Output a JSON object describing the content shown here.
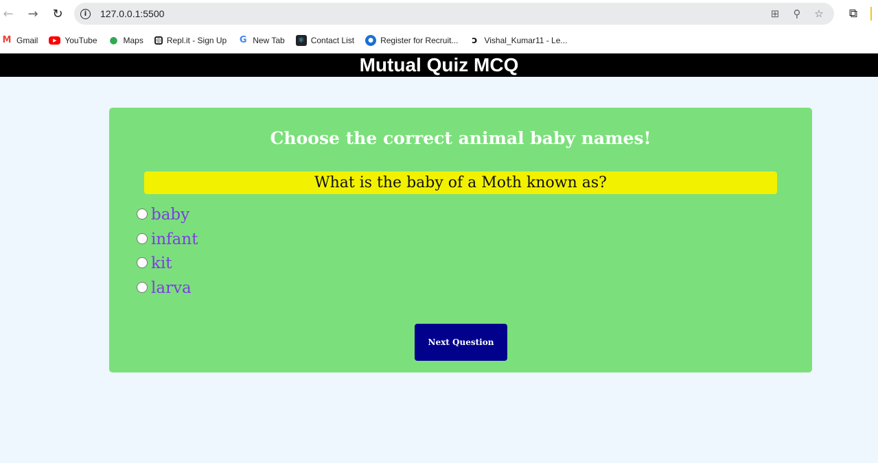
{
  "browser": {
    "url": "127.0.0.1:5500",
    "bookmarks": [
      {
        "label": "Gmail",
        "icon": "gmail-icon"
      },
      {
        "label": "YouTube",
        "icon": "youtube-icon"
      },
      {
        "label": "Maps",
        "icon": "maps-icon"
      },
      {
        "label": "Repl.it - Sign Up",
        "icon": "replit-icon"
      },
      {
        "label": "New Tab",
        "icon": "google-icon"
      },
      {
        "label": "Contact List",
        "icon": "react-icon"
      },
      {
        "label": "Register for Recruit...",
        "icon": "sbi-icon"
      },
      {
        "label": "Vishal_Kumar11 - Le...",
        "icon": "leetcode-icon"
      }
    ]
  },
  "header": {
    "title": "Mutual Quiz MCQ"
  },
  "quiz": {
    "heading": "Choose the correct animal baby names!",
    "question": "What is the baby of a Moth known as?",
    "options": [
      "baby",
      "infant",
      "kit",
      "larva"
    ],
    "next_label": "Next Question"
  },
  "colors": {
    "header_bg": "#000000",
    "card_bg": "#7be07b",
    "question_bg": "#f2f200",
    "option_text": "#7a3fe0",
    "button_bg": "#01018c",
    "page_bg": "#eef6fe"
  }
}
